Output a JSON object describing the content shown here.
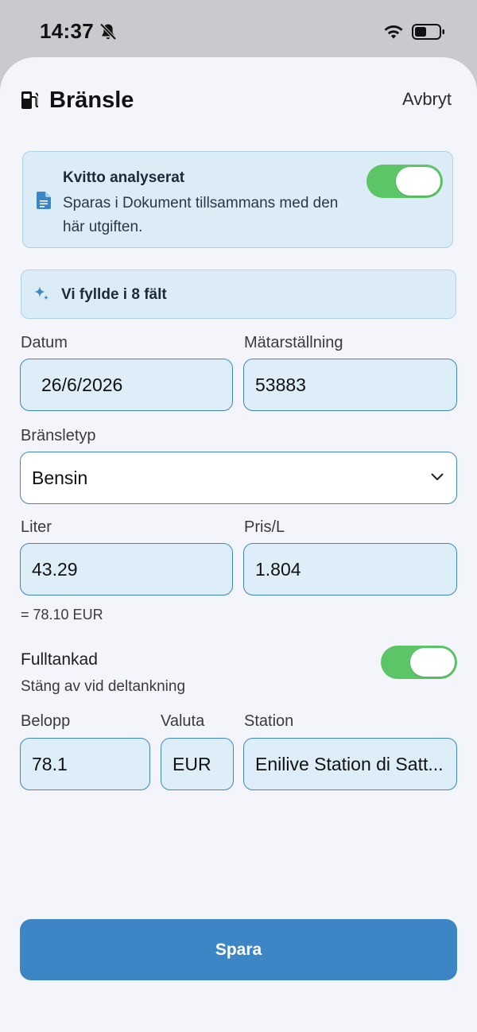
{
  "status_bar": {
    "time": "14:37"
  },
  "header": {
    "title": "Bränsle",
    "cancel_label": "Avbryt"
  },
  "receipt_card": {
    "title": "Kvitto analyserat",
    "description": "Sparas i Dokument tillsammans med den här utgiften.",
    "toggle_on": true
  },
  "autofill_banner": {
    "text": "Vi fyllde i 8 fält"
  },
  "form": {
    "date": {
      "label": "Datum",
      "value": "26/6/2026"
    },
    "odometer": {
      "label": "Mätarställning",
      "value": "53883"
    },
    "fuel_type": {
      "label": "Bränsletyp",
      "value": "Bensin"
    },
    "liters": {
      "label": "Liter",
      "value": "43.29"
    },
    "price_per_liter": {
      "label": "Pris/L",
      "value": "1.804"
    },
    "computed_total": "= 78.10 EUR",
    "full_tank": {
      "label": "Fulltankad",
      "hint": "Stäng av vid deltankning",
      "toggle_on": true
    },
    "amount": {
      "label": "Belopp",
      "value": "78.1"
    },
    "currency": {
      "label": "Valuta",
      "value": "EUR"
    },
    "station": {
      "label": "Station",
      "value": "Enilive Station di Satt..."
    }
  },
  "save_button": {
    "label": "Spara"
  },
  "colors": {
    "accent": "#3c86c5",
    "toggle_green": "#5cc567",
    "field_fill": "#ddeef9",
    "sheet_background": "#f4f5fa"
  }
}
